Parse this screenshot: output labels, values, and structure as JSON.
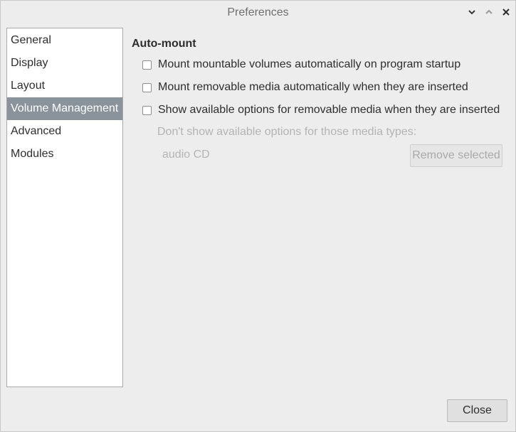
{
  "window": {
    "title": "Preferences"
  },
  "sidebar": {
    "items": [
      {
        "label": "General",
        "selected": false
      },
      {
        "label": "Display",
        "selected": false
      },
      {
        "label": "Layout",
        "selected": false
      },
      {
        "label": "Volume Management",
        "selected": true
      },
      {
        "label": "Advanced",
        "selected": false
      },
      {
        "label": "Modules",
        "selected": false
      }
    ]
  },
  "main": {
    "section_title": "Auto-mount",
    "options": [
      {
        "label": "Mount mountable volumes automatically on program startup",
        "checked": false
      },
      {
        "label": "Mount removable media automatically when they are inserted",
        "checked": false
      },
      {
        "label": "Show available options for removable media when they are inserted",
        "checked": false
      }
    ],
    "media_types_label": "Don't show available options for those media types:",
    "media_types": [
      "audio CD"
    ],
    "remove_selected_label": "Remove selected"
  },
  "footer": {
    "close_label": "Close"
  },
  "icons": {
    "minimize": "chevron-down-icon",
    "maximize": "chevron-up-icon",
    "close": "close-icon"
  },
  "colors": {
    "selection": "#8a939c",
    "disabled_text": "#b4b4b4"
  }
}
